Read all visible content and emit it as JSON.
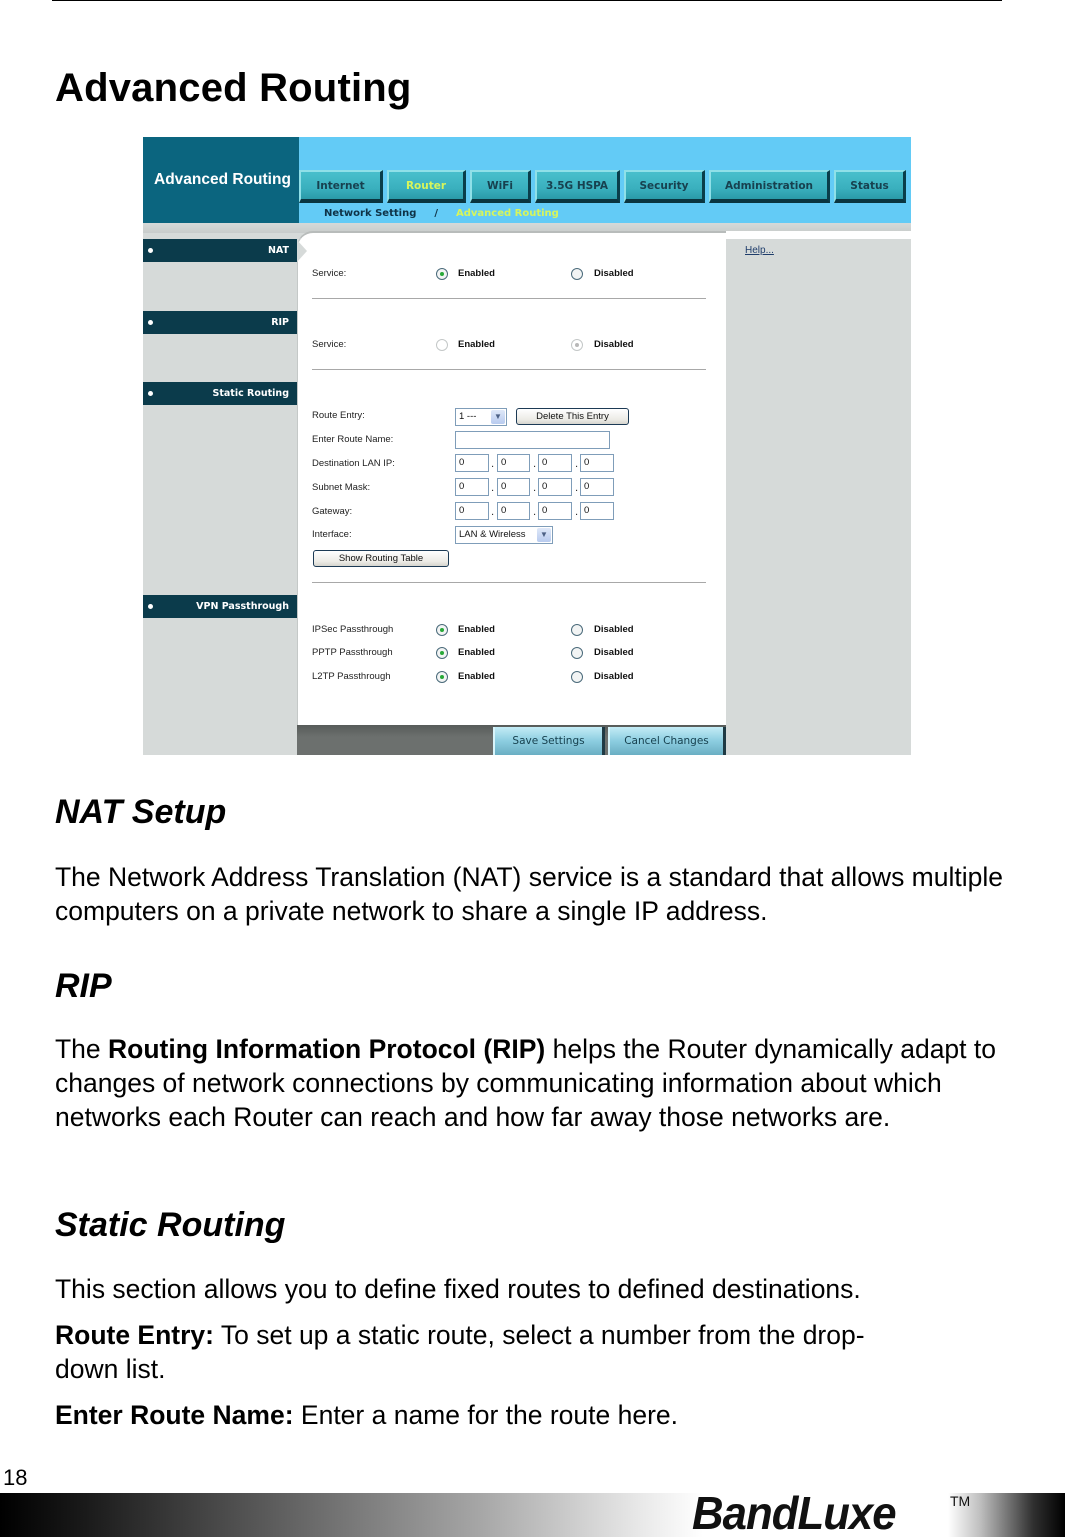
{
  "page": {
    "title": "Advanced Routing",
    "page_number": "18",
    "brand": "BandLuxe",
    "trademark": "TM"
  },
  "router_ui": {
    "header_title": "Advanced Routing",
    "tabs": [
      {
        "label": "Internet",
        "active": false
      },
      {
        "label": "Router",
        "active": true
      },
      {
        "label": "WiFi",
        "active": false
      },
      {
        "label": "3.5G HSPA",
        "active": false
      },
      {
        "label": "Security",
        "active": false
      },
      {
        "label": "Administration",
        "active": false
      },
      {
        "label": "Status",
        "active": false
      }
    ],
    "breadcrumb": {
      "parent": "Network Setting",
      "separator": "/",
      "current": "Advanced Routing"
    },
    "help_link": "Help...",
    "sidebar": [
      {
        "label": "NAT"
      },
      {
        "label": "RIP"
      },
      {
        "label": "Static Routing"
      },
      {
        "label": "VPN Passthrough"
      }
    ],
    "nat": {
      "label": "Service:",
      "enabled_label": "Enabled",
      "disabled_label": "Disabled",
      "value": "Enabled"
    },
    "rip": {
      "label": "Service:",
      "enabled_label": "Enabled",
      "disabled_label": "Disabled",
      "value": "Disabled"
    },
    "static_routing": {
      "route_entry_label": "Route Entry:",
      "route_entry_value": "1 ---",
      "delete_button": "Delete This Entry",
      "route_name_label": "Enter Route Name:",
      "route_name_value": "",
      "dest_ip_label": "Destination LAN IP:",
      "dest_ip": [
        "0",
        "0",
        "0",
        "0"
      ],
      "subnet_label": "Subnet Mask:",
      "subnet": [
        "0",
        "0",
        "0",
        "0"
      ],
      "gateway_label": "Gateway:",
      "gateway": [
        "0",
        "0",
        "0",
        "0"
      ],
      "dot": ".",
      "interface_label": "Interface:",
      "interface_value": "LAN & Wireless",
      "show_table_button": "Show Routing Table"
    },
    "vpn": {
      "enabled_label": "Enabled",
      "disabled_label": "Disabled",
      "rows": [
        {
          "label": "IPSec Passthrough",
          "value": "Enabled"
        },
        {
          "label": "PPTP Passthrough",
          "value": "Enabled"
        },
        {
          "label": "L2TP Passthrough",
          "value": "Enabled"
        }
      ]
    },
    "save_button": "Save Settings",
    "cancel_button": "Cancel Changes"
  },
  "sections": {
    "nat": {
      "heading": "NAT Setup",
      "body": "The Network Address Translation (NAT) service is a standard that allows multiple computers on a private network to share a single IP address."
    },
    "rip": {
      "heading": "RIP",
      "intro": "The ",
      "bold": "Routing Information Protocol (RIP)",
      "rest": " helps the Router dynamically adapt to changes of network connections by communicating information about which networks each Router can reach and how far away those networks are."
    },
    "static": {
      "heading": "Static Routing",
      "body": "This section allows you to define fixed routes to defined destinations.",
      "route_entry_term": "Route Entry:",
      "route_entry_desc": " To set up a static route, select a number from the drop-down list.",
      "route_name_term": "Enter Route Name:",
      "route_name_desc": " Enter a name for the route here."
    }
  }
}
